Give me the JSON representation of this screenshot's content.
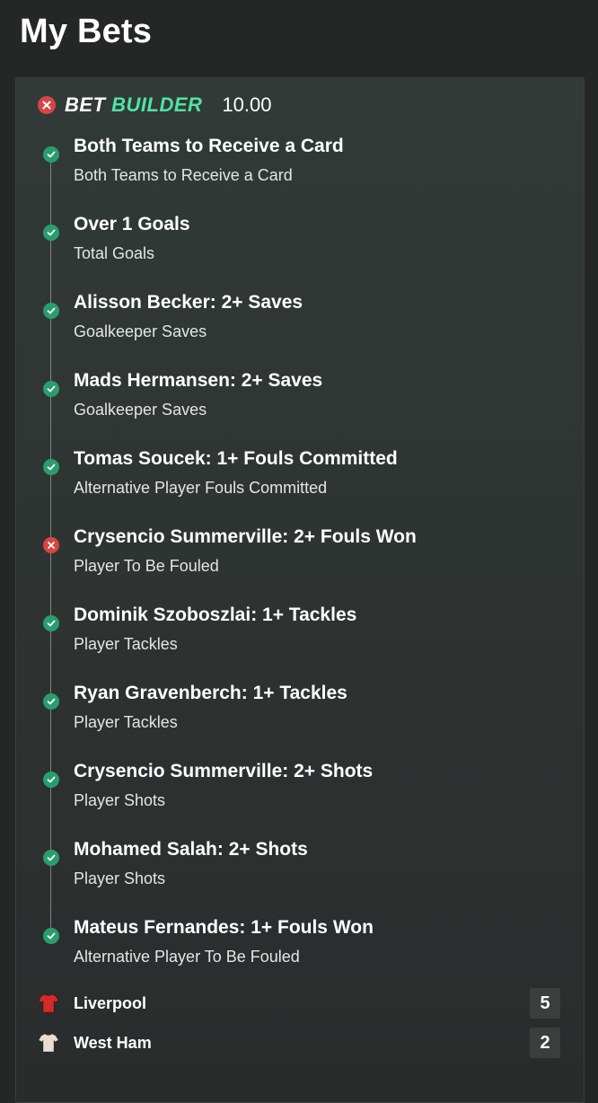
{
  "page": {
    "title": "My Bets"
  },
  "bet": {
    "status": "lost",
    "brand_part1": "BET",
    "brand_part2": "BUILDER",
    "stake": "10.00",
    "legs": [
      {
        "title": "Both Teams to Receive a Card",
        "market": "Both Teams to Receive a Card",
        "status": "won"
      },
      {
        "title": "Over 1 Goals",
        "market": "Total Goals",
        "status": "won"
      },
      {
        "title": "Alisson Becker: 2+ Saves",
        "market": "Goalkeeper Saves",
        "status": "won"
      },
      {
        "title": "Mads Hermansen: 2+ Saves",
        "market": "Goalkeeper Saves",
        "status": "won"
      },
      {
        "title": "Tomas Soucek: 1+ Fouls Committed",
        "market": "Alternative Player Fouls Committed",
        "status": "won"
      },
      {
        "title": "Crysencio Summerville: 2+ Fouls Won",
        "market": "Player To Be Fouled",
        "status": "lost"
      },
      {
        "title": "Dominik Szoboszlai: 1+ Tackles",
        "market": "Player Tackles",
        "status": "won"
      },
      {
        "title": "Ryan Gravenberch: 1+ Tackles",
        "market": "Player Tackles",
        "status": "won"
      },
      {
        "title": "Crysencio Summerville: 2+ Shots",
        "market": "Player Shots",
        "status": "won"
      },
      {
        "title": "Mohamed Salah: 2+ Shots",
        "market": "Player Shots",
        "status": "won"
      },
      {
        "title": "Mateus Fernandes: 1+ Fouls Won",
        "market": "Alternative Player To Be Fouled",
        "status": "won"
      }
    ],
    "teams": [
      {
        "name": "Liverpool",
        "score": "5",
        "shirt_color": "#d42a2a",
        "shirt_icon": "red-shirt-icon"
      },
      {
        "name": "West Ham",
        "score": "2",
        "shirt_color": "#e8ddd0",
        "shirt_icon": "white-shirt-icon"
      }
    ]
  },
  "colors": {
    "accent": "#4fe3a6",
    "won": "#2a9d6d",
    "lost": "#d64545"
  }
}
